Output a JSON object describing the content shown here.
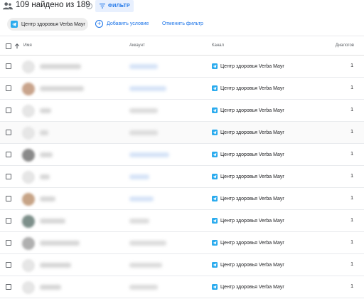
{
  "header": {
    "count_text": "109 найдено из 189",
    "help_glyph": "?",
    "filter_label": "ФИЛЬТР"
  },
  "filters": {
    "chip_label": "Центр здоровья Verba Mayr",
    "add_condition": "Добавить условие",
    "cancel_filter": "Отменить фильтр",
    "plus_glyph": "+"
  },
  "table": {
    "columns": {
      "name": "Имя",
      "account": "Аккаунт",
      "channel": "Канал",
      "dialogs": "Диалогов"
    },
    "rows": [
      {
        "channel": "Центр здоровья Verba Mayr",
        "dialogs": "1",
        "avatar_color": "#e6e6e6"
      },
      {
        "channel": "Центр здоровья Verba Mayr",
        "dialogs": "1",
        "avatar_color": "#c9a48c"
      },
      {
        "channel": "Центр здоровья Verba Mayr",
        "dialogs": "1",
        "avatar_color": "#e6e6e6"
      },
      {
        "channel": "Центр здоровья Verba Mayr",
        "dialogs": "1",
        "avatar_color": "#e6e6e6"
      },
      {
        "channel": "Центр здоровья Verba Mayr",
        "dialogs": "1",
        "avatar_color": "#8a8a8a"
      },
      {
        "channel": "Центр здоровья Verba Mayr",
        "dialogs": "1",
        "avatar_color": "#e6e6e6"
      },
      {
        "channel": "Центр здоровья Verba Mayr",
        "dialogs": "1",
        "avatar_color": "#c7a487"
      },
      {
        "channel": "Центр здоровья Verba Mayr",
        "dialogs": "1",
        "avatar_color": "#7d8f8a"
      },
      {
        "channel": "Центр здоровья Verba Mayr",
        "dialogs": "1",
        "avatar_color": "#b0b0b0"
      },
      {
        "channel": "Центр здоровья Verba Mayr",
        "dialogs": "1",
        "avatar_color": "#e6e6e6"
      },
      {
        "channel": "Центр здоровья Verba Mayr",
        "dialogs": "1",
        "avatar_color": "#e6e6e6"
      }
    ]
  },
  "colors": {
    "accent": "#1a73e8",
    "telegram": "#2aabee"
  }
}
